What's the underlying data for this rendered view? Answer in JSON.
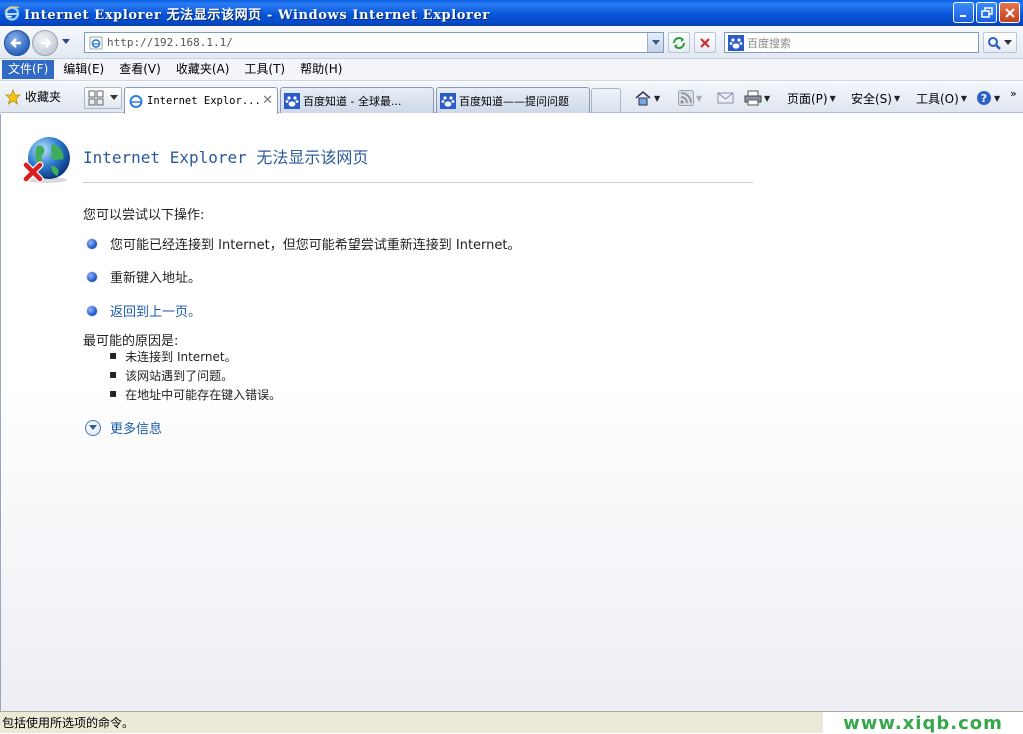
{
  "window": {
    "title": "Internet Explorer 无法显示该网页 - Windows Internet Explorer",
    "buttons": {
      "minimize": "minimize-icon",
      "restore": "restore-icon",
      "close": "close-icon"
    }
  },
  "address_bar": {
    "url": "http://192.168.1.1/",
    "search_placeholder": "百度搜索"
  },
  "menu": {
    "items": [
      "文件(F)",
      "编辑(E)",
      "查看(V)",
      "收藏夹(A)",
      "工具(T)",
      "帮助(H)"
    ],
    "active_index": 0
  },
  "favorites_bar": {
    "favorites_label": "收藏夹",
    "tabs": [
      {
        "label": "Internet Explor...",
        "active": true
      },
      {
        "label": "百度知道 - 全球最...",
        "active": false
      },
      {
        "label": "百度知道——提问问题",
        "active": false
      }
    ],
    "commands": {
      "page": "页面(P)",
      "safety": "安全(S)",
      "tools": "工具(O)"
    }
  },
  "error_page": {
    "title": "Internet Explorer 无法显示该网页",
    "try_heading": "您可以尝试以下操作:",
    "try_items": [
      {
        "text": "您可能已经连接到 Internet，但您可能希望尝试重新连接到 Internet。",
        "link": false
      },
      {
        "text": "重新键入地址。",
        "link": false
      },
      {
        "text": "返回到上一页。",
        "link": true
      }
    ],
    "reasons_heading": "最可能的原因是:",
    "reasons": [
      "未连接到 Internet。",
      "该网站遇到了问题。",
      "在地址中可能存在键入错误。"
    ],
    "more_info": "更多信息"
  },
  "status_bar": {
    "text": "包括使用所选项的命令。",
    "watermark": "www.xiqb.com"
  },
  "colors": {
    "title_bar": "#0856d8",
    "link": "#1d5aa8",
    "menu_highlight": "#316ac5",
    "watermark": "#36a84a"
  }
}
